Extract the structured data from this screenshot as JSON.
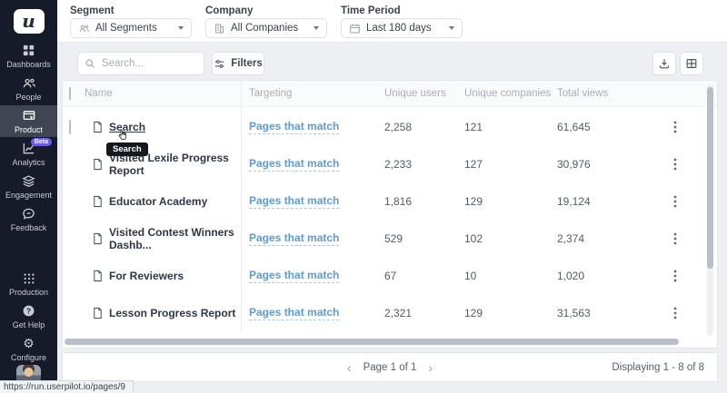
{
  "app": {
    "logo_letter": "u",
    "status_url": "https://run.userpilot.io/pages/9"
  },
  "sidebar": {
    "selected": "Product",
    "items": [
      {
        "label": "Dashboards"
      },
      {
        "label": "People"
      },
      {
        "label": "Product"
      },
      {
        "label": "Analytics",
        "badge": "Beta"
      },
      {
        "label": "Engagement"
      },
      {
        "label": "Feedback"
      },
      {
        "label": "Production"
      },
      {
        "label": "Get Help"
      },
      {
        "label": "Configure"
      }
    ]
  },
  "filter_bar": {
    "segment": {
      "label": "Segment",
      "value": "All Segments"
    },
    "company": {
      "label": "Company",
      "value": "All Companies"
    },
    "time_period": {
      "label": "Time Period",
      "value": "Last 180 days"
    }
  },
  "toolbar": {
    "search_placeholder": "Search...",
    "filters_label": "Filters"
  },
  "table": {
    "columns": {
      "name": "Name",
      "targeting": "Targeting",
      "unique_users": "Unique users",
      "unique_companies": "Unique companies",
      "total_views": "Total views"
    },
    "rows": [
      {
        "name": "Search",
        "targeting": "Pages that match",
        "unique_users": "2,258",
        "unique_companies": "121",
        "total_views": "61,645"
      },
      {
        "name": "Visited Lexile Progress Report",
        "targeting": "Pages that match",
        "unique_users": "2,233",
        "unique_companies": "127",
        "total_views": "30,976"
      },
      {
        "name": "Educator Academy",
        "targeting": "Pages that match",
        "unique_users": "1,816",
        "unique_companies": "129",
        "total_views": "19,124"
      },
      {
        "name": "Visited Contest Winners Dashb...",
        "targeting": "Pages that match",
        "unique_users": "529",
        "unique_companies": "102",
        "total_views": "2,374"
      },
      {
        "name": "For Reviewers",
        "targeting": "Pages that match",
        "unique_users": "67",
        "unique_companies": "10",
        "total_views": "1,020"
      },
      {
        "name": "Lesson Progress Report",
        "targeting": "Pages that match",
        "unique_users": "2,321",
        "unique_companies": "129",
        "total_views": "31,563"
      }
    ]
  },
  "hover": {
    "tooltip": "Search"
  },
  "pagination": {
    "prev": "‹",
    "page_label": "Page 1 of 1",
    "next": "›",
    "displaying": "Displaying 1 - 8 of 8"
  },
  "colors": {
    "link": "#5e9bd4",
    "sidebar_bg": "#151b28",
    "selected_item_bg": "#3f4653",
    "beta_badge": "#6c5ce7",
    "page_bg": "#edeff3"
  }
}
